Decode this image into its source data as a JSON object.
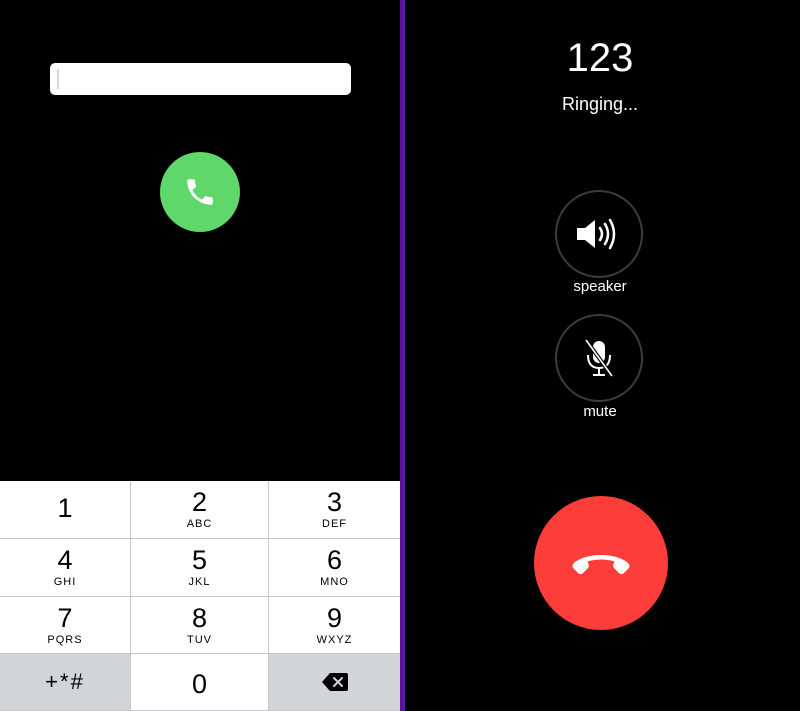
{
  "dialer": {
    "number_value": "",
    "keys": [
      {
        "digit": "1",
        "letters": ""
      },
      {
        "digit": "2",
        "letters": "ABC"
      },
      {
        "digit": "3",
        "letters": "DEF"
      },
      {
        "digit": "4",
        "letters": "GHI"
      },
      {
        "digit": "5",
        "letters": "JKL"
      },
      {
        "digit": "6",
        "letters": "MNO"
      },
      {
        "digit": "7",
        "letters": "PQRS"
      },
      {
        "digit": "8",
        "letters": "TUV"
      },
      {
        "digit": "9",
        "letters": "WXYZ"
      }
    ],
    "symbols_label": "+*#",
    "zero_digit": "0",
    "call_icon": "phone-icon",
    "backspace_icon": "backspace-icon",
    "colors": {
      "call_green": "#5fd76a",
      "keypad_bg": "#ffffff",
      "function_key_bg": "#d1d4d9"
    }
  },
  "divider_color": "#5b189a",
  "call": {
    "number": "123",
    "status": "Ringing...",
    "speaker_label": "speaker",
    "mute_label": "mute",
    "speaker_icon": "speaker-icon",
    "mute_icon": "microphone-muted-icon",
    "end_call_icon": "hang-up-icon",
    "colors": {
      "end_call_red": "#fc3d39"
    }
  }
}
